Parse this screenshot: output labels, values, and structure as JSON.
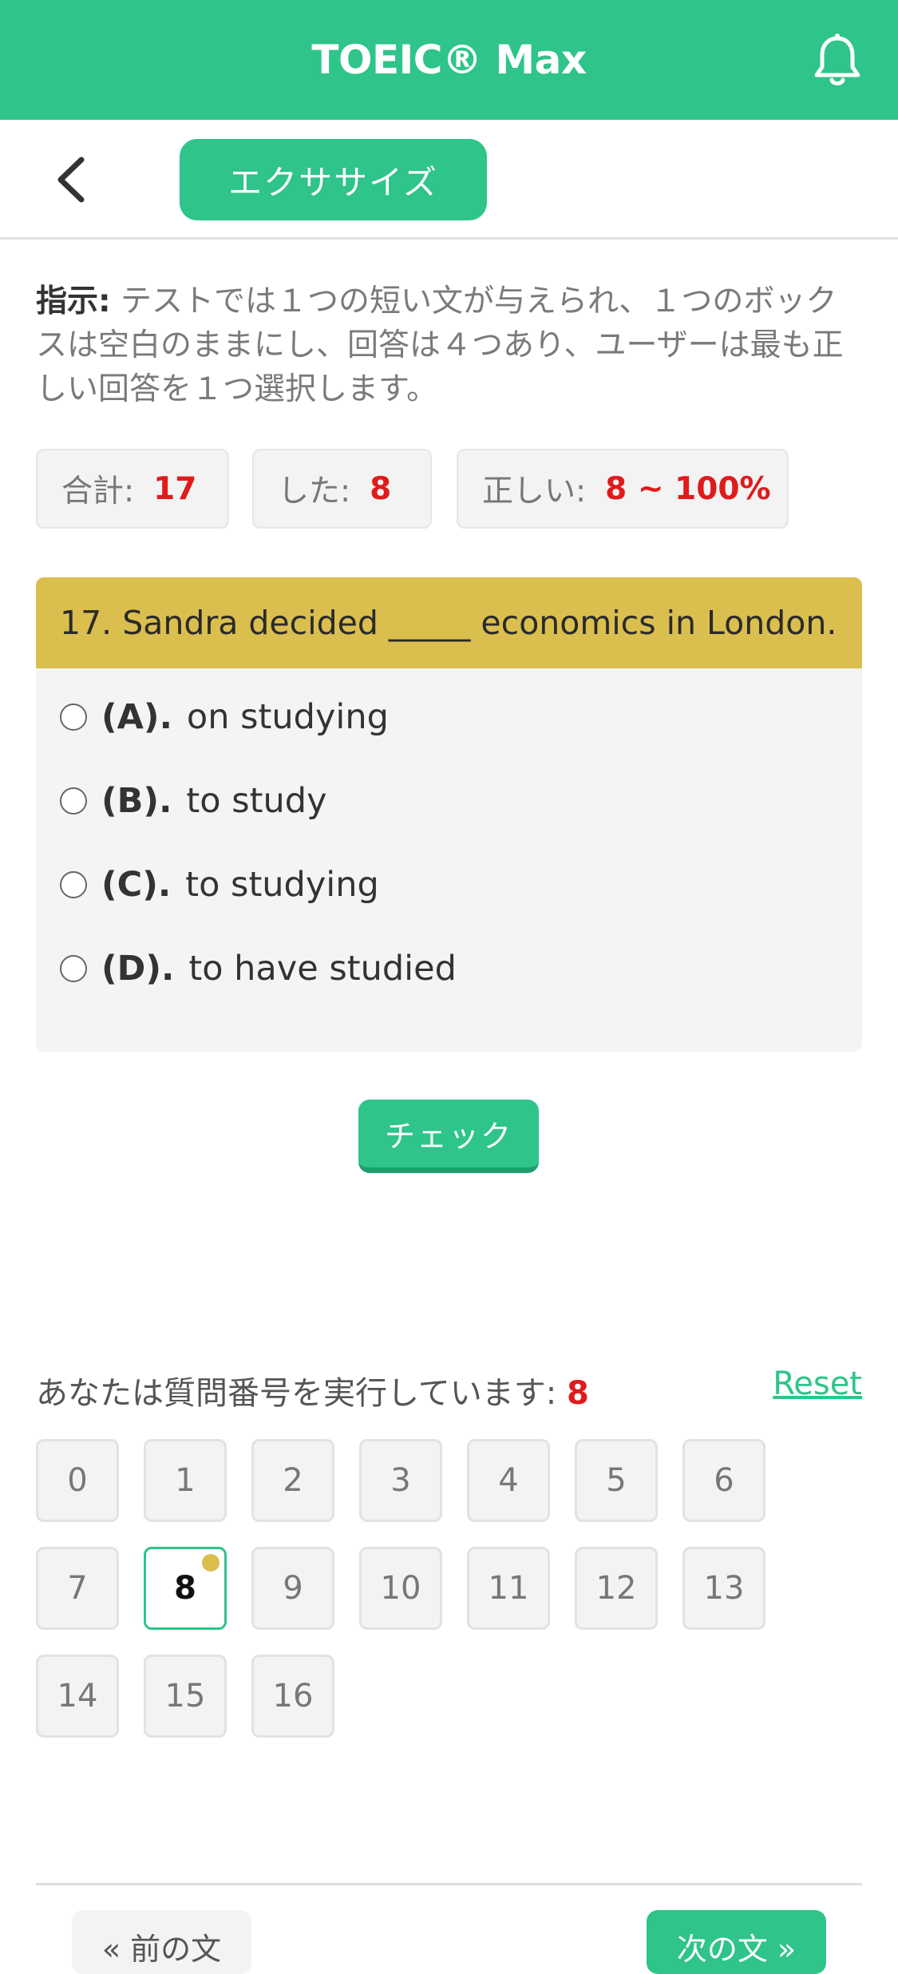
{
  "header": {
    "title": "TOEIC® Max",
    "bell_icon": "bell-icon"
  },
  "subheader": {
    "back_icon": "chevron-left-icon",
    "exercise_label": "エクササイズ"
  },
  "instruction": {
    "label": "指示:",
    "text": " テストでは１つの短い文が与えられ、１つのボックスは空白のままにし、回答は４つあり、ユーザーは最も正しい回答を１つ選択します。"
  },
  "stats": {
    "total_label": "合計:",
    "total_value": "17",
    "done_label": "した:",
    "done_value": "8",
    "correct_label": "正しい:",
    "correct_value": "8 ~ 100%"
  },
  "question": {
    "text": "17. Sandra decided _____ economics in London.",
    "options": [
      {
        "letter": "(A).",
        "text": "on studying"
      },
      {
        "letter": "(B).",
        "text": "to study"
      },
      {
        "letter": "(C).",
        "text": "to studying"
      },
      {
        "letter": "(D).",
        "text": "to have studied"
      }
    ]
  },
  "check_label": "チェック",
  "progress": {
    "running_label": "あなたは質問番号を実行しています:",
    "current": "8",
    "reset_label": "Reset",
    "numbers": [
      "0",
      "1",
      "2",
      "3",
      "4",
      "5",
      "6",
      "7",
      "8",
      "9",
      "10",
      "11",
      "12",
      "13",
      "14",
      "15",
      "16"
    ]
  },
  "nav": {
    "prev_label": "« 前の文",
    "next_label": "次の文 »"
  },
  "colors": {
    "accent": "#2ec48a",
    "question_header": "#dbbf4e",
    "highlight": "#e01b1b"
  }
}
